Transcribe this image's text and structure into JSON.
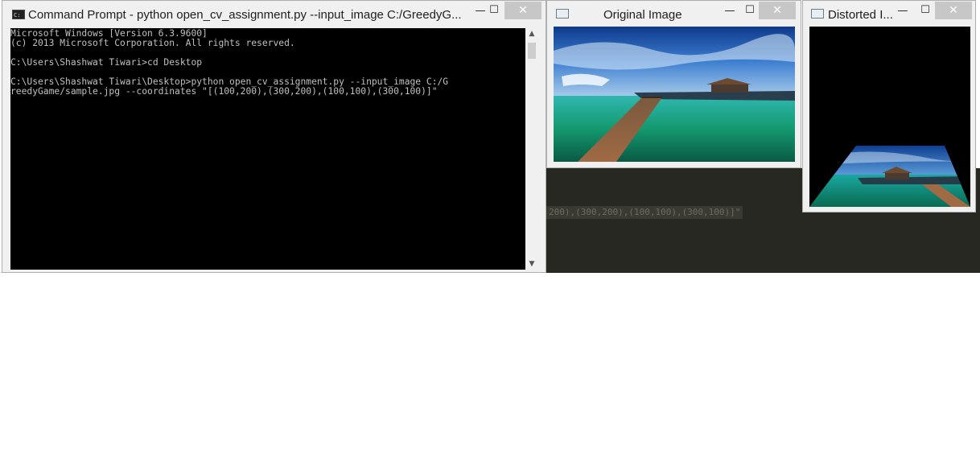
{
  "cmd_window": {
    "title": "Command Prompt - python  open_cv_assignment.py --input_image C:/GreedyG...",
    "controls": {
      "minimize": "—",
      "maximize": "☐",
      "close": "✕"
    },
    "console_lines": [
      "Microsoft Windows [Version 6.3.9600]",
      "(c) 2013 Microsoft Corporation. All rights reserved.",
      "",
      "C:\\Users\\Shashwat Tiwari>cd Desktop",
      "",
      "C:\\Users\\Shashwat Tiwari\\Desktop>python open_cv_assignment.py --input_image C:/G",
      "reedyGame/sample.jpg --coordinates \"[(100,200),(300,200),(100,100),(300,100)]\""
    ]
  },
  "original_window": {
    "title": "Original Image",
    "controls": {
      "minimize": "—",
      "maximize": "☐",
      "close": "✕"
    },
    "image_icon": "tropical-pier-photo"
  },
  "distorted_window": {
    "title": "Distorted I...",
    "controls": {
      "minimize": "—",
      "maximize": "☐",
      "close": "✕"
    },
    "image_icon": "warped-pier-photo"
  },
  "background_editor": {
    "text": "200),(300,200),(100,100),(300,100)]\""
  },
  "colors": {
    "console_bg": "#000000",
    "console_fg": "#c0c0c0",
    "editor_bg": "#272822",
    "close_button": "#c7c7c7"
  }
}
